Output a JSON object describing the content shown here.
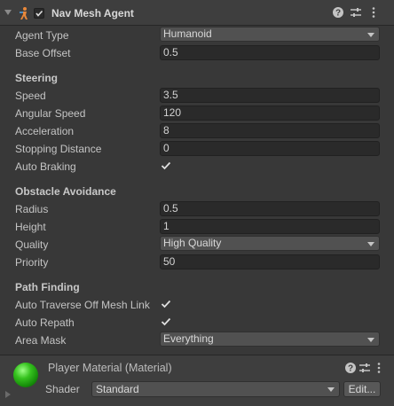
{
  "component": {
    "title": "Nav Mesh Agent",
    "enabled": true,
    "icons": [
      "help-icon",
      "preset-icon",
      "kebab-menu-icon"
    ]
  },
  "fields": {
    "agent_type": {
      "label": "Agent Type",
      "value": "Humanoid"
    },
    "base_offset": {
      "label": "Base Offset",
      "value": "0.5"
    }
  },
  "steering": {
    "header": "Steering",
    "speed": {
      "label": "Speed",
      "value": "3.5"
    },
    "angular_speed": {
      "label": "Angular Speed",
      "value": "120"
    },
    "acceleration": {
      "label": "Acceleration",
      "value": "8"
    },
    "stopping_distance": {
      "label": "Stopping Distance",
      "value": "0"
    },
    "auto_braking": {
      "label": "Auto Braking",
      "checked": true
    }
  },
  "obstacle": {
    "header": "Obstacle Avoidance",
    "radius": {
      "label": "Radius",
      "value": "0.5"
    },
    "height": {
      "label": "Height",
      "value": "1"
    },
    "quality": {
      "label": "Quality",
      "value": "High Quality"
    },
    "priority": {
      "label": "Priority",
      "value": "50"
    }
  },
  "path": {
    "header": "Path Finding",
    "auto_traverse": {
      "label": "Auto Traverse Off Mesh Link",
      "checked": true
    },
    "auto_repath": {
      "label": "Auto Repath",
      "checked": true
    },
    "area_mask": {
      "label": "Area Mask",
      "value": "Everything"
    }
  },
  "material": {
    "title": "Player Material (Material)",
    "shader_label": "Shader",
    "shader_value": "Standard",
    "edit_label": "Edit..."
  }
}
